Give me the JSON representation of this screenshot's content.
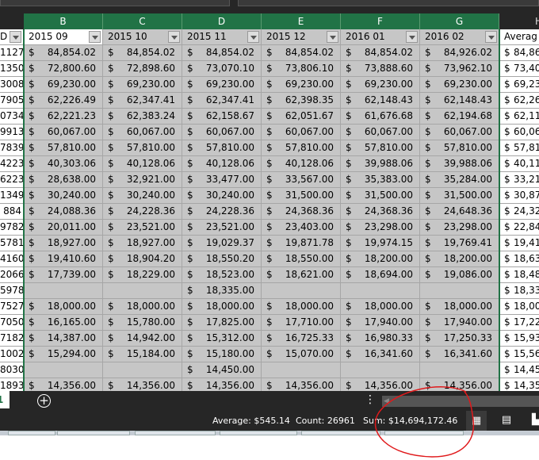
{
  "columns": [
    "B",
    "C",
    "D",
    "E",
    "F",
    "G",
    "H"
  ],
  "header_row": {
    "a": "D",
    "cols": [
      "2015 09",
      "2015 10",
      "2015 11",
      "2015 12",
      "2016 01",
      "2016 02",
      "Averag"
    ]
  },
  "currency": "$",
  "rows": [
    {
      "a": "1127",
      "v": [
        "84,854.02",
        "84,854.02",
        "84,854.02",
        "84,854.02",
        "84,854.02",
        "84,926.02"
      ],
      "h": "84,86"
    },
    {
      "a": "1350",
      "v": [
        "72,800.60",
        "72,898.60",
        "73,070.10",
        "73,806.10",
        "73,888.60",
        "73,962.10"
      ],
      "h": "73,40"
    },
    {
      "a": "3008",
      "v": [
        "69,230.00",
        "69,230.00",
        "69,230.00",
        "69,230.00",
        "69,230.00",
        "69,230.00"
      ],
      "h": "69,23"
    },
    {
      "a": "7905",
      "v": [
        "62,226.49",
        "62,347.41",
        "62,347.41",
        "62,398.35",
        "62,148.43",
        "62,148.43"
      ],
      "h": "62,26"
    },
    {
      "a": "0734",
      "v": [
        "62,221.23",
        "62,383.24",
        "62,158.67",
        "62,051.67",
        "61,676.68",
        "62,194.68"
      ],
      "h": "62,11"
    },
    {
      "a": "9913",
      "v": [
        "60,067.00",
        "60,067.00",
        "60,067.00",
        "60,067.00",
        "60,067.00",
        "60,067.00"
      ],
      "h": "60,06"
    },
    {
      "a": "7839",
      "v": [
        "57,810.00",
        "57,810.00",
        "57,810.00",
        "57,810.00",
        "57,810.00",
        "57,810.00"
      ],
      "h": "57,81"
    },
    {
      "a": "4223",
      "v": [
        "40,303.06",
        "40,128.06",
        "40,128.06",
        "40,128.06",
        "39,988.06",
        "39,988.06"
      ],
      "h": "40,11"
    },
    {
      "a": "6223",
      "v": [
        "28,638.00",
        "32,921.00",
        "33,477.00",
        "33,567.00",
        "35,383.00",
        "35,284.00"
      ],
      "h": "33,21"
    },
    {
      "a": "1349",
      "v": [
        "30,240.00",
        "30,240.00",
        "30,240.00",
        "31,500.00",
        "31,500.00",
        "31,500.00"
      ],
      "h": "30,87"
    },
    {
      "a": "884",
      "v": [
        "24,088.36",
        "24,228.36",
        "24,228.36",
        "24,368.36",
        "24,368.36",
        "24,648.36"
      ],
      "h": "24,32"
    },
    {
      "a": "9782",
      "v": [
        "20,011.00",
        "23,521.00",
        "23,521.00",
        "23,403.00",
        "23,298.00",
        "23,298.00"
      ],
      "h": "22,84"
    },
    {
      "a": "5781",
      "v": [
        "18,927.00",
        "18,927.00",
        "19,029.37",
        "19,871.78",
        "19,974.15",
        "19,769.41"
      ],
      "h": "19,41"
    },
    {
      "a": "4160",
      "v": [
        "19,410.60",
        "18,904.20",
        "18,550.20",
        "18,550.00",
        "18,200.00",
        "18,200.00"
      ],
      "h": "18,63"
    },
    {
      "a": "2066",
      "v": [
        "17,739.00",
        "18,229.00",
        "18,523.00",
        "18,621.00",
        "18,694.00",
        "19,086.00"
      ],
      "h": "18,48"
    },
    {
      "a": "5978",
      "v": [
        null,
        null,
        "18,335.00",
        null,
        null,
        null
      ],
      "h": "18,33"
    },
    {
      "a": "7527",
      "v": [
        "18,000.00",
        "18,000.00",
        "18,000.00",
        "18,000.00",
        "18,000.00",
        "18,000.00"
      ],
      "h": "18,00"
    },
    {
      "a": "7050",
      "v": [
        "16,165.00",
        "15,780.00",
        "17,825.00",
        "17,710.00",
        "17,940.00",
        "17,940.00"
      ],
      "h": "17,22"
    },
    {
      "a": "7182",
      "v": [
        "14,387.00",
        "14,942.00",
        "15,312.00",
        "16,725.33",
        "16,980.33",
        "17,250.33"
      ],
      "h": "15,93"
    },
    {
      "a": "1002",
      "v": [
        "15,294.00",
        "15,184.00",
        "15,180.00",
        "15,070.00",
        "16,341.60",
        "16,341.60"
      ],
      "h": "15,56"
    },
    {
      "a": "8030",
      "v": [
        null,
        null,
        "14,450.00",
        null,
        null,
        null
      ],
      "h": "14,45"
    },
    {
      "a": "1893",
      "v": [
        "14,356.00",
        "14,356.00",
        "14,356.00",
        "14,356.00",
        "14,356.00",
        "14,356.00"
      ],
      "h": "14,35"
    }
  ],
  "sheet_tab": "1",
  "add_sheet": "+",
  "status": {
    "average": "Average: $545.14",
    "count": "Count: 26961",
    "sum": "Sum: $14,694,172.46"
  },
  "annotation_color": "#e0191b"
}
